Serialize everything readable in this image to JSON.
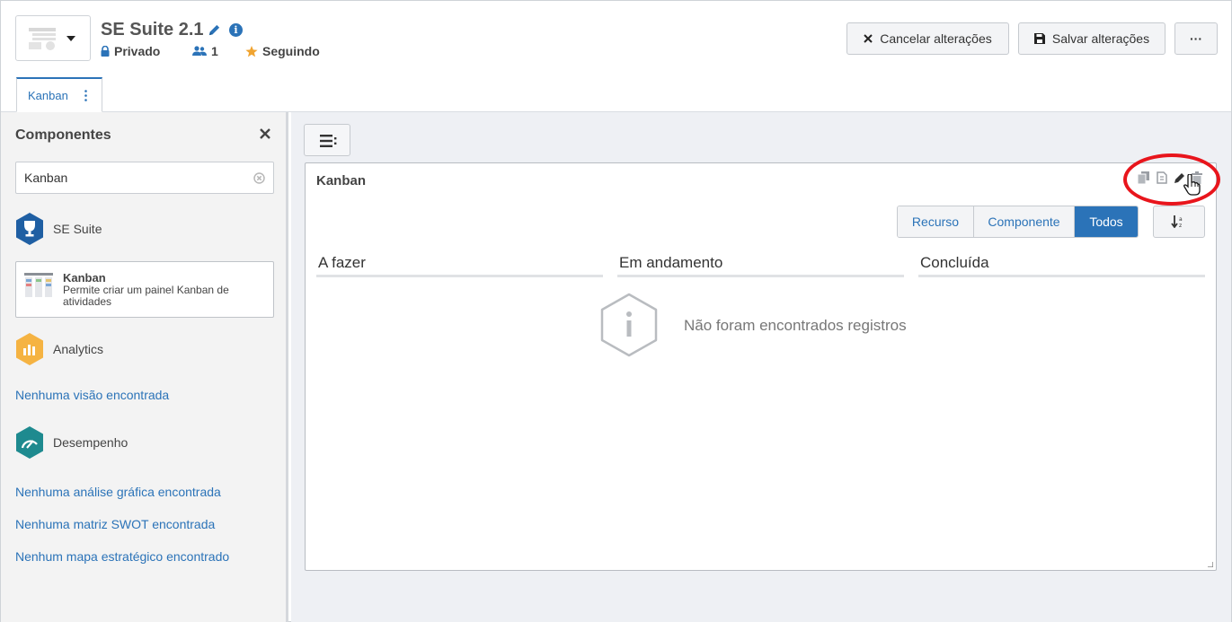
{
  "header": {
    "title": "SE Suite 2.1",
    "privacy": "Privado",
    "members_count": "1",
    "follow_status": "Seguindo",
    "cancel_label": "Cancelar alterações",
    "save_label": "Salvar alterações",
    "more_label": "···"
  },
  "tabs": [
    {
      "label": "Kanban",
      "active": true
    }
  ],
  "sidebar": {
    "title": "Componentes",
    "search": {
      "value": "Kanban",
      "placeholder": ""
    },
    "sections": {
      "se_suite": "SE Suite",
      "analytics": "Analytics",
      "desempenho": "Desempenho"
    },
    "card": {
      "title": "Kanban",
      "description": "Permite criar um painel Kanban de atividades"
    },
    "links": {
      "no_views": "Nenhuma visão encontrada",
      "no_graphic": "Nenhuma análise gráfica encontrada",
      "no_swot": "Nenhuma matriz SWOT encontrada",
      "no_map": "Nenhum mapa estratégico encontrado"
    }
  },
  "panel": {
    "title": "Kanban",
    "filters": [
      {
        "label": "Recurso",
        "active": false
      },
      {
        "label": "Componente",
        "active": false
      },
      {
        "label": "Todos",
        "active": true
      }
    ],
    "columns": [
      "A fazer",
      "Em andamento",
      "Concluída"
    ],
    "empty_message": "Não foram encontrados registros"
  },
  "colors": {
    "accent": "#2b73b8",
    "highlight_ring": "#e8151c",
    "se_suite_icon": "#1f5fa3",
    "analytics_icon": "#f5b342",
    "desempenho_icon": "#1e8a8f"
  }
}
